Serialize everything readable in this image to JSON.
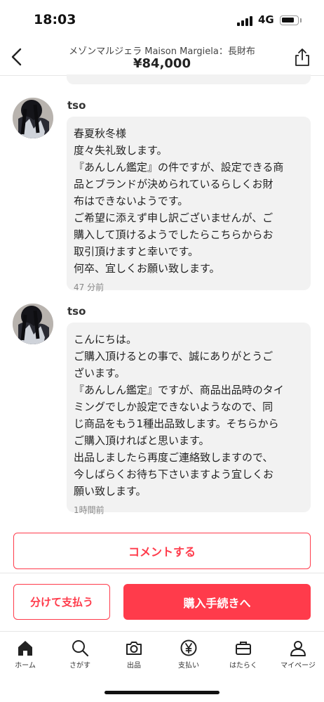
{
  "status_bar": {
    "time": "18:03",
    "network": "4G"
  },
  "header": {
    "title": "メゾンマルジェラ Maison Margiela：長財布",
    "price": "¥84,000",
    "back_icon": "chevron-left-icon",
    "share_icon": "share-icon"
  },
  "comments": [
    {
      "user": "tso",
      "lines": [
        "春夏秋冬様",
        "度々失礼致します。",
        "『あんしん鑑定』の件ですが、設定できる商",
        "品とブランドが決められているらしくお財",
        "布はできないようです。",
        "ご希望に添えず申し訳ございませんが、ご",
        "購入して頂けるようでしたらこちらからお",
        "取引頂けますと幸いです。",
        "何卒、宜しくお願い致します。"
      ],
      "time": "47 分前"
    },
    {
      "user": "tso",
      "lines": [
        "こんにちは。",
        "ご購入頂けるとの事で、誠にありがとうご",
        "ざいます。",
        "『あんしん鑑定』ですが、商品出品時のタイ",
        "ミングでしか設定できないようなので、同",
        "じ商品をもう1種出品致します。そちらから",
        "ご購入頂ければと思います。",
        "出品しましたら再度ご連絡致しますので、",
        "今しばらくお待ち下さいますよう宜しくお",
        "願い致します。"
      ],
      "time": "1時間前"
    }
  ],
  "actions": {
    "comment_label": "コメントする",
    "split_pay_label": "分けて支払う",
    "buy_label": "購入手続きへ"
  },
  "tabs": [
    {
      "label": "ホーム",
      "icon": "home-icon"
    },
    {
      "label": "さがす",
      "icon": "search-icon"
    },
    {
      "label": "出品",
      "icon": "camera-icon"
    },
    {
      "label": "支払い",
      "icon": "yen-icon"
    },
    {
      "label": "はたらく",
      "icon": "briefcase-icon"
    },
    {
      "label": "マイページ",
      "icon": "person-icon"
    }
  ],
  "colors": {
    "accent": "#ff3b4b",
    "bubble_bg": "#f2f2f2"
  }
}
